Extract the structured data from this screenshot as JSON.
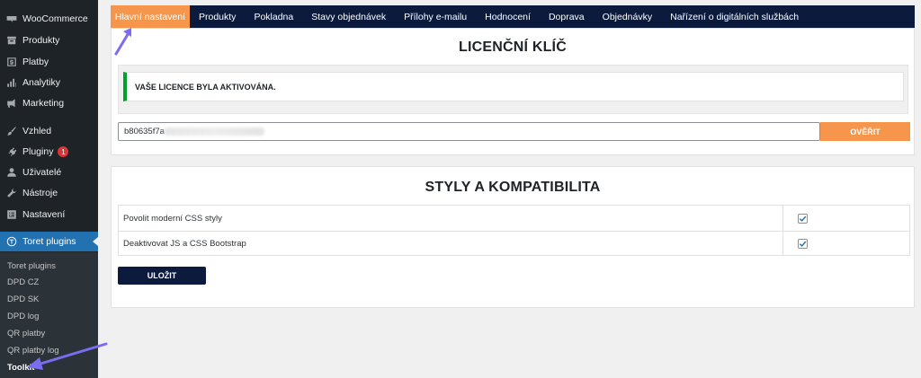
{
  "sidebar": {
    "items": [
      {
        "label": "WooCommerce",
        "icon": "woo-icon"
      },
      {
        "label": "Produkty",
        "icon": "archive-icon"
      },
      {
        "label": "Platby",
        "icon": "dollar-icon"
      },
      {
        "label": "Analytiky",
        "icon": "chart-bar-icon"
      },
      {
        "label": "Marketing",
        "icon": "megaphone-icon"
      },
      {
        "label": "Vzhled",
        "icon": "brush-icon"
      },
      {
        "label": "Pluginy",
        "icon": "plug-icon",
        "badge": "1"
      },
      {
        "label": "Uživatelé",
        "icon": "user-icon"
      },
      {
        "label": "Nástroje",
        "icon": "wrench-icon"
      },
      {
        "label": "Nastavení",
        "icon": "settings-icon"
      },
      {
        "label": "Toret plugins",
        "icon": "toret-icon",
        "active": true
      }
    ],
    "submenu": [
      "Toret plugins",
      "DPD CZ",
      "DPD SK",
      "DPD log",
      "QR platby",
      "QR platby log",
      "Toolkit"
    ],
    "current_submenu": "Toolkit"
  },
  "tabs": [
    {
      "label": "Hlavní nastavení",
      "active": true
    },
    {
      "label": "Produkty"
    },
    {
      "label": "Pokladna"
    },
    {
      "label": "Stavy objednávek"
    },
    {
      "label": "Přílohy e-mailu"
    },
    {
      "label": "Hodnocení"
    },
    {
      "label": "Doprava"
    },
    {
      "label": "Objednávky"
    },
    {
      "label": "Nařízení o digitálních službách"
    }
  ],
  "license": {
    "title": "LICENČNÍ KLÍČ",
    "notice": "VAŠE LICENCE BYLA AKTIVOVÁNA.",
    "key_value": "b80635f7a",
    "verify_label": "OVĚŘIT"
  },
  "styles": {
    "title": "STYLY A KOMPATIBILITA",
    "options": [
      {
        "label": "Povolit moderní CSS styly",
        "checked": true
      },
      {
        "label": "Deaktivovat JS a CSS Bootstrap",
        "checked": true
      }
    ],
    "save_label": "ULOŽIT"
  },
  "colors": {
    "tab_bar": "#0b1a3d",
    "accent_orange": "#f6964c",
    "sidebar_active": "#2271b1",
    "success_green": "#00a32a",
    "annotation_arrow": "#7b6cf0"
  }
}
